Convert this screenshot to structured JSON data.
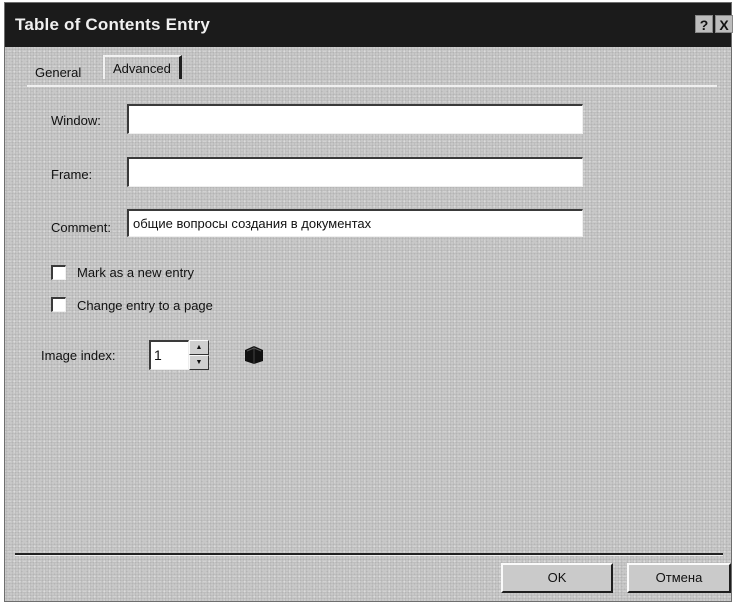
{
  "window": {
    "title": "Table of Contents Entry",
    "help_glyph": "?",
    "close_glyph": "X"
  },
  "tabs": [
    {
      "label": "General",
      "selected": false
    },
    {
      "label": "Advanced",
      "selected": true
    }
  ],
  "fields": {
    "window": {
      "label": "Window:",
      "value": ""
    },
    "frame": {
      "label": "Frame:",
      "value": ""
    },
    "comment": {
      "label": "Comment:",
      "value": "общие вопросы создания в документах"
    }
  },
  "checkboxes": [
    {
      "label": "Mark as a new entry",
      "checked": false
    },
    {
      "label": "Change entry to a page",
      "checked": false
    }
  ],
  "image_index": {
    "label": "Image index:",
    "value": "1",
    "icon": "book-icon"
  },
  "buttons": {
    "ok": "OK",
    "cancel": "Отмена"
  }
}
